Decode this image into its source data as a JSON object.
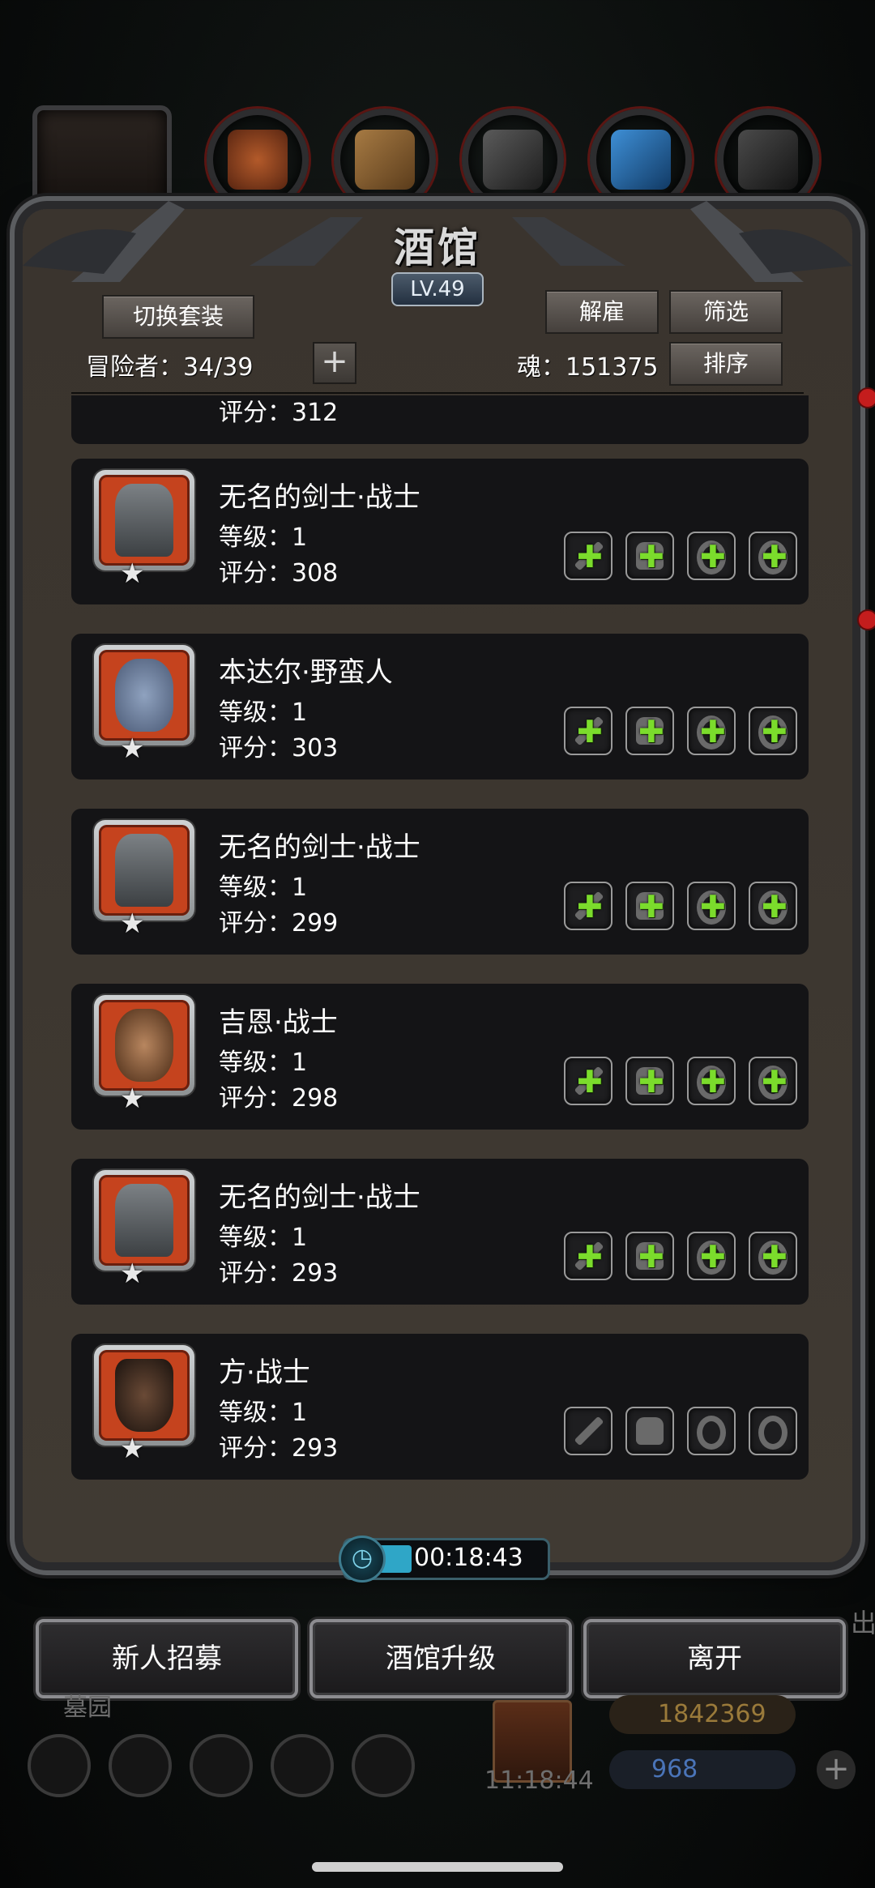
{
  "window": {
    "title": "酒馆",
    "level": "LV.49",
    "switch_outfit_label": "切换套装",
    "dismiss_label": "解雇",
    "filter_label": "筛选",
    "sort_label": "排序",
    "adventurers_label": "冒险者：34/39",
    "add_label": "+",
    "soul_label": "魂：151375"
  },
  "partial_row": {
    "score": "评分：312"
  },
  "heroes": [
    {
      "name": "无名的剑士·战士",
      "level": "等级：1",
      "score": "评分：308",
      "portrait": "helmet-knight",
      "slots": [
        "weapon-plus",
        "armor-plus",
        "ring-plus",
        "ring-plus"
      ]
    },
    {
      "name": "本达尔·野蛮人",
      "level": "等级：1",
      "score": "评分：303",
      "portrait": "horned-barbarian",
      "slots": [
        "weapon-plus",
        "armor-plus",
        "ring-plus",
        "ring-plus"
      ]
    },
    {
      "name": "无名的剑士·战士",
      "level": "等级：1",
      "score": "评分：299",
      "portrait": "helmet-knight",
      "slots": [
        "weapon-plus",
        "armor-plus",
        "ring-plus",
        "ring-plus"
      ]
    },
    {
      "name": "吉恩·战士",
      "level": "等级：1",
      "score": "评分：298",
      "portrait": "long-haired-man",
      "slots": [
        "weapon-plus",
        "armor-plus",
        "ring-plus",
        "ring-plus"
      ]
    },
    {
      "name": "无名的剑士·战士",
      "level": "等级：1",
      "score": "评分：293",
      "portrait": "helmet-knight",
      "slots": [
        "weapon-plus",
        "armor-plus",
        "ring-plus",
        "ring-plus"
      ]
    },
    {
      "name": "方·战士",
      "level": "等级：1",
      "score": "评分：293",
      "portrait": "hat-swordsman",
      "slots": [
        "weapon",
        "armor",
        "ring",
        "ring"
      ]
    }
  ],
  "timer": {
    "time": "00:18:43"
  },
  "buttons": {
    "recruit_label": "新人招募",
    "upgrade_label": "酒馆升级",
    "leave_label": "离开"
  },
  "hud": {
    "location": "墓园",
    "clock": "11:18:44",
    "gold": "1842369",
    "gems": "968",
    "side_text": "出"
  },
  "colors": {
    "accent_green": "#7bdc2c",
    "portrait_frame": "#c5431e",
    "timer_fill": "#2fa6c7"
  }
}
